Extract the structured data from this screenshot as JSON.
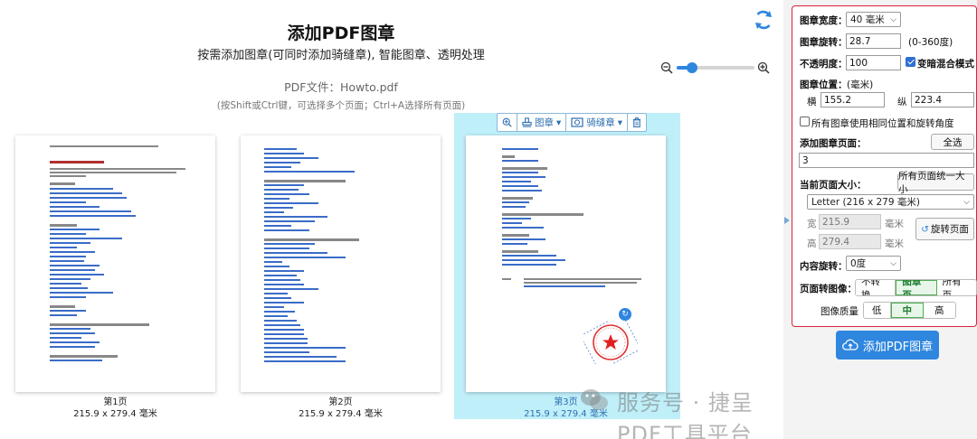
{
  "header": {
    "title": "添加PDF图章",
    "subtitle": "按需添加图章(可同时添加骑缝章), 智能图章、透明处理",
    "file_line": "PDF文件：Howto.pdf",
    "hint_line": "(按Shift或Ctrl键，可选择多个页面；Ctrl+A选择所有页面)"
  },
  "zoom": {
    "level": 0.2
  },
  "toolbar": {
    "stamp_label": "图章",
    "seam_label": "骑缝章"
  },
  "pages": [
    {
      "label": "第1页",
      "size": "215.9 x 279.4 毫米",
      "selected": false
    },
    {
      "label": "第2页",
      "size": "215.9 x 279.4 毫米",
      "selected": false
    },
    {
      "label": "第3页",
      "size": "215.9 x 279.4 毫米",
      "selected": true
    }
  ],
  "page1": {
    "heading": "Dialogue How-To Index"
  },
  "watermark": "服务号 · 捷呈PDF工具平台",
  "panel": {
    "stamp_width_label": "图章宽度：",
    "stamp_width_value": "40 毫米",
    "rotation_label": "图章旋转：",
    "rotation_value": "28.7",
    "rotation_range": "(0-360度)",
    "opacity_label": "不透明度：",
    "opacity_value": "100",
    "blend_label": "变暗混合模式",
    "blend_checked": true,
    "position_label": "图章位置：",
    "position_unit": "(毫米)",
    "x_label": "横",
    "x_value": "155.2",
    "y_label": "纵",
    "y_value": "223.4",
    "same_pos_label": "所有图章使用相同位置和旋转角度",
    "same_pos_checked": false,
    "pages_label": "添加图章页面：",
    "select_all_label": "全选",
    "pages_value": "3",
    "page_size_label": "当前页面大小：",
    "unify_label": "所有页面统一大小",
    "page_size_value": "Letter (216 x 279 毫米)",
    "width_label": "宽",
    "width_value": "215.9",
    "height_label": "高",
    "height_value": "279.4",
    "mm": "毫米",
    "rotate_page_label": "旋转页面",
    "content_rot_label": "内容旋转：",
    "content_rot_value": "0度",
    "convert_label": "页面转图像：",
    "convert_options": [
      "不转换",
      "图章页",
      "所有页"
    ],
    "convert_selected": 1,
    "quality_label": "图像质量",
    "quality_options": [
      "低",
      "中",
      "高"
    ],
    "quality_selected": 1,
    "add_button": "添加PDF图章"
  },
  "colors": {
    "accent": "#2e86de",
    "panel_border": "#d9233a",
    "selected_bg": "#bfeff9"
  }
}
